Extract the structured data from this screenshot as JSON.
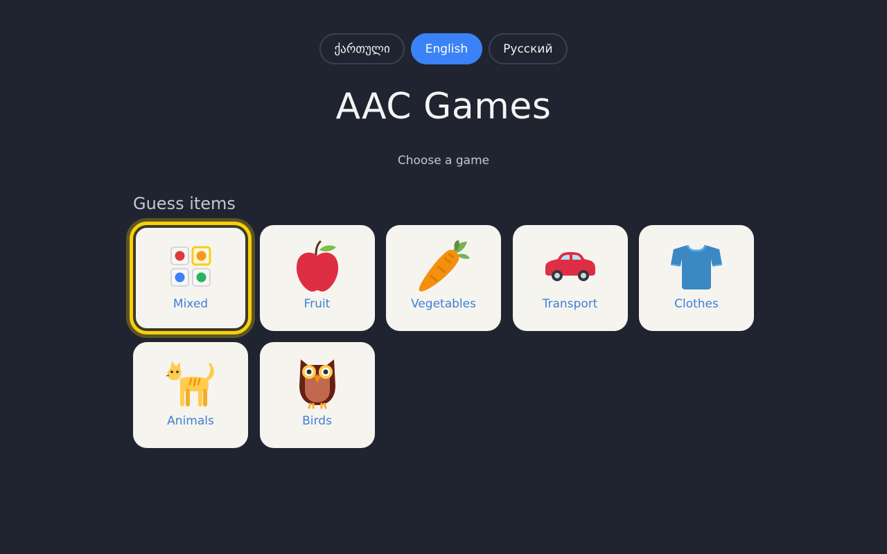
{
  "languages": [
    {
      "label": "ქართული",
      "active": false
    },
    {
      "label": "English",
      "active": true
    },
    {
      "label": "Русский",
      "active": false
    }
  ],
  "title": "AAC Games",
  "subtitle": "Choose a game",
  "section": {
    "title": "Guess items",
    "tiles": [
      {
        "label": "Mixed",
        "icon": "grid-icon",
        "selected": true
      },
      {
        "label": "Fruit",
        "icon": "apple-icon",
        "selected": false
      },
      {
        "label": "Vegetables",
        "icon": "carrot-icon",
        "selected": false
      },
      {
        "label": "Transport",
        "icon": "car-icon",
        "selected": false
      },
      {
        "label": "Clothes",
        "icon": "tshirt-icon",
        "selected": false
      },
      {
        "label": "Animals",
        "icon": "cat-icon",
        "selected": false
      },
      {
        "label": "Birds",
        "icon": "owl-icon",
        "selected": false
      }
    ]
  },
  "colors": {
    "background": "#202430",
    "accent": "#3b82f6",
    "tile": "#f6f4ef",
    "tile_label": "#3d7fd6",
    "selection": "#f7d00a"
  }
}
